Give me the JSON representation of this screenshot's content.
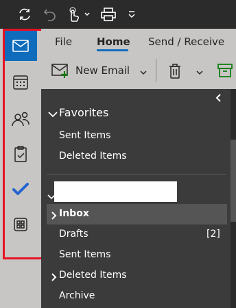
{
  "ribbon": {
    "tabs": [
      "File",
      "Home",
      "Send / Receive"
    ],
    "new_email_label": "New Email"
  },
  "folders": {
    "favorites_header": "Favorites",
    "favorites": [
      "Sent Items",
      "Deleted Items"
    ],
    "account_name": "",
    "items": [
      {
        "label": "Inbox",
        "badge": ""
      },
      {
        "label": "Drafts",
        "badge": "[2]"
      },
      {
        "label": "Sent Items",
        "badge": ""
      },
      {
        "label": "Deleted Items",
        "badge": ""
      },
      {
        "label": "Archive",
        "badge": ""
      }
    ]
  },
  "colors": {
    "accent": "#0f6cbd",
    "highlight": "#e81123",
    "todo": "#2564cf"
  }
}
